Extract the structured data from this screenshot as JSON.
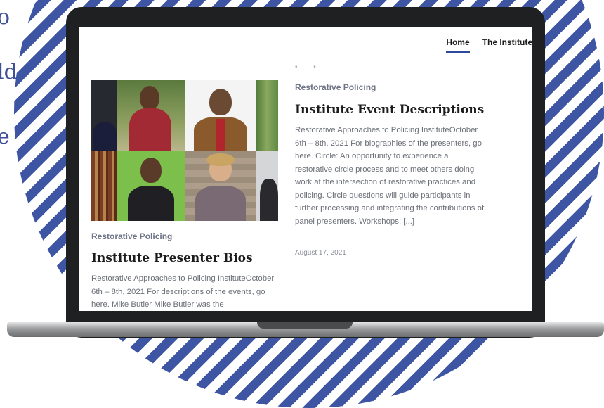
{
  "side_text": [
    "o",
    "ld",
    "e"
  ],
  "nav": {
    "home": "Home",
    "institute": "The Institute"
  },
  "posts": [
    {
      "category": "Restorative Policing",
      "title": "Institute Presenter Bios",
      "excerpt": "Restorative Approaches to Policing InstituteOctober 6th – 8th, 2021 For descriptions of the events, go here. Mike Butler Mike Butler was the"
    },
    {
      "category": "Restorative Policing",
      "title": "Institute Event Descriptions",
      "excerpt": "Restorative Approaches to Policing InstituteOctober 6th – 8th, 2021 For biographies of the presenters, go here. Circle: An opportunity to experience a restorative circle process and to meet others doing work at the intersection of restorative practices and policing. Circle questions will guide participants in further processing and integrating the contributions of panel presenters. Workshops: [...]",
      "date": "August 17, 2021"
    }
  ],
  "colors": {
    "stripe_blue": "#3d55a3",
    "laptop_frame": "#1f2021",
    "nav_underline": "#2b4a9a",
    "category_gray": "#6f7486"
  },
  "icons": [
    "presenter-photo-collage"
  ]
}
